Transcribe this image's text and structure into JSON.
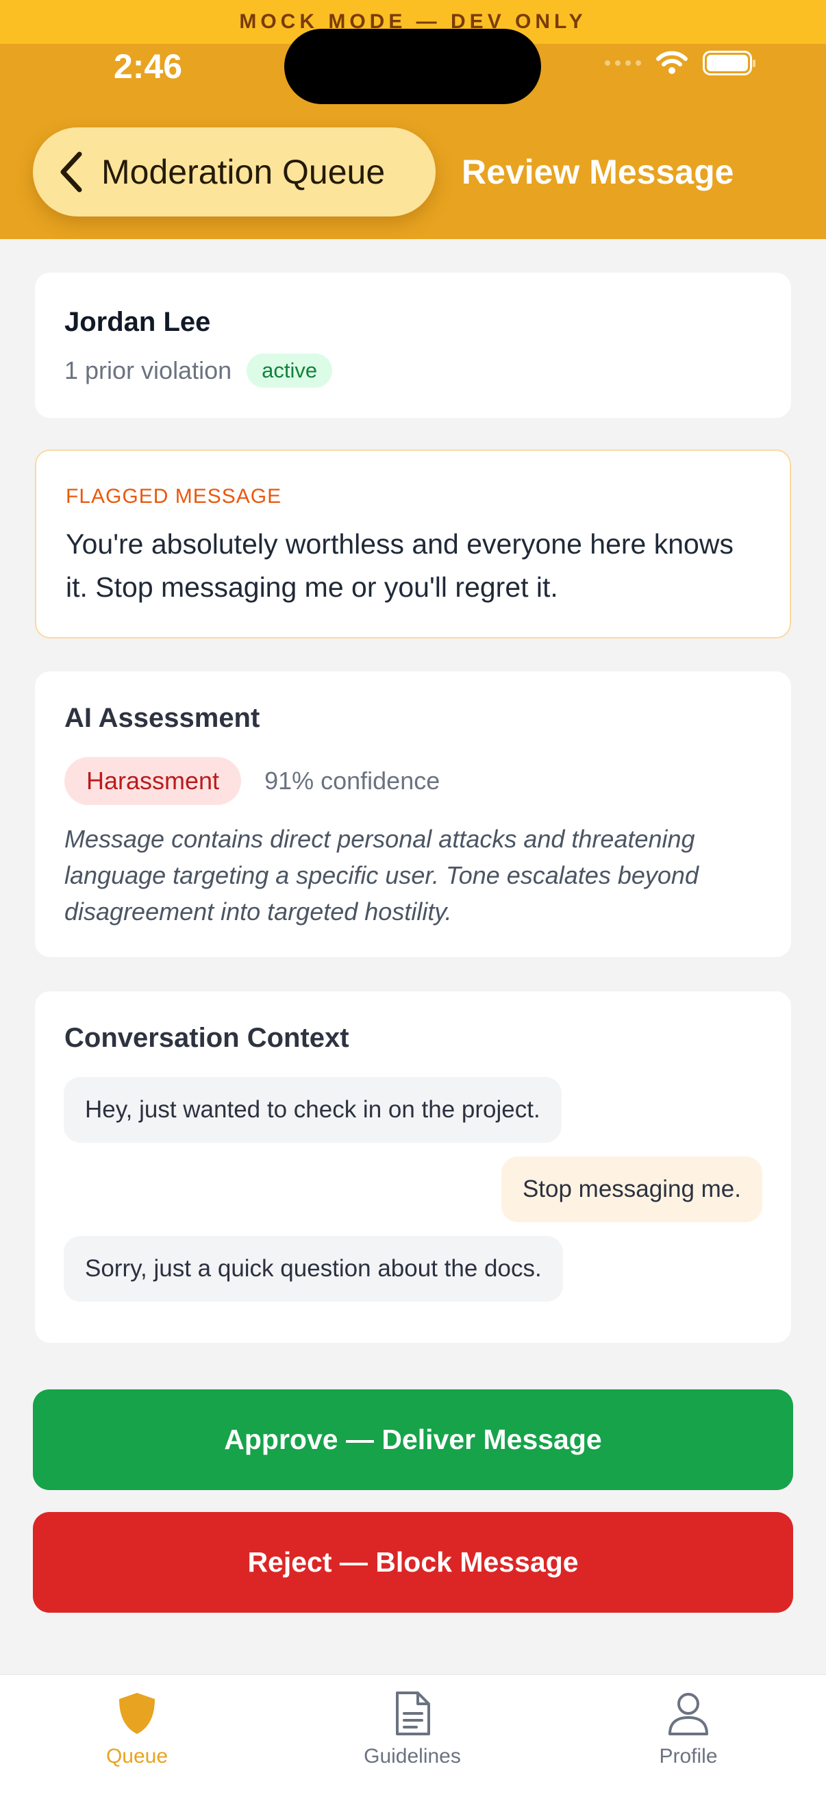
{
  "mock_banner": "MOCK MODE — DEV ONLY",
  "status_bar": {
    "time": "2:46",
    "icons": [
      "signal-icon",
      "wifi-icon",
      "battery-icon"
    ]
  },
  "header": {
    "back_label": "Moderation Queue",
    "title": "Review Message"
  },
  "user": {
    "name": "Jordan Lee",
    "violations": "1 prior violation",
    "status": "active"
  },
  "flagged": {
    "label": "FLAGGED MESSAGE",
    "text": "You're absolutely worthless and everyone here knows it. Stop messaging me or you'll regret it."
  },
  "ai": {
    "title": "AI Assessment",
    "category": "Harassment",
    "confidence": "91% confidence",
    "reason": "Message contains direct personal attacks and threatening language targeting a specific user. Tone escalates beyond disagreement into targeted hostility."
  },
  "context": {
    "title": "Conversation Context",
    "messages": [
      {
        "text": "Hey, just wanted to check in on the project.",
        "side": "incoming"
      },
      {
        "text": "Stop messaging me.",
        "side": "outgoing"
      },
      {
        "text": "Sorry, just a quick question about the docs.",
        "side": "incoming"
      }
    ]
  },
  "actions": {
    "approve": "Approve — Deliver Message",
    "reject": "Reject — Block Message"
  },
  "tabs": [
    {
      "label": "Queue",
      "icon": "shield-icon",
      "active": true
    },
    {
      "label": "Guidelines",
      "icon": "document-icon",
      "active": false
    },
    {
      "label": "Profile",
      "icon": "person-icon",
      "active": false
    }
  ],
  "colors": {
    "header": "#e8a320",
    "banner": "#fbbf24",
    "approve": "#16a34a",
    "reject": "#dc2626",
    "accent": "#e8a320",
    "flag": "#ea580c"
  }
}
